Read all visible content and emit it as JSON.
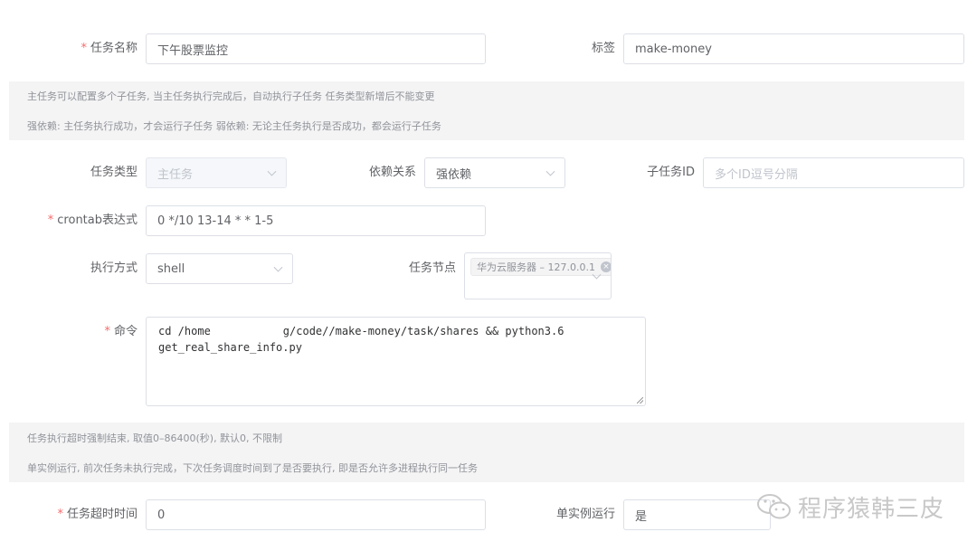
{
  "form": {
    "task_name": {
      "label": "任务名称",
      "value": "下午股票监控",
      "required": true
    },
    "tag": {
      "label": "标签",
      "value": "make-money"
    },
    "tips1": [
      "主任务可以配置多个子任务, 当主任务执行完成后，自动执行子任务 任务类型新增后不能变更",
      "强依赖: 主任务执行成功，才会运行子任务 弱依赖: 无论主任务执行是否成功，都会运行子任务"
    ],
    "task_type": {
      "label": "任务类型",
      "value": "主任务",
      "disabled": true
    },
    "dependency": {
      "label": "依赖关系",
      "value": "强依赖"
    },
    "child_task_id": {
      "label": "子任务ID",
      "placeholder": "多个ID逗号分隔"
    },
    "crontab": {
      "label": "crontab表达式",
      "value": "0 */10 13-14 * * 1-5",
      "required": true
    },
    "exec_mode": {
      "label": "执行方式",
      "value": "shell"
    },
    "task_node": {
      "label": "任务节点",
      "tag": "华为云服务器 – 127.0.0.1",
      "tag_close": "×"
    },
    "command": {
      "label": "命令",
      "required": true,
      "line1_pre": "cd /home",
      "line1_post": "g/code//make-money/task/shares && python3.6",
      "line2": "get_real_share_info.py"
    },
    "tips2": [
      "任务执行超时强制结束, 取值0–86400(秒), 默认0, 不限制",
      "单实例运行, 前次任务未执行完成，下次任务调度时间到了是否要执行, 即是否允许多进程执行同一任务"
    ],
    "timeout": {
      "label": "任务超时时间",
      "value": "0",
      "required": true
    },
    "single_instance": {
      "label": "单实例运行",
      "value": "是"
    },
    "required_mark": "*"
  },
  "watermark": {
    "text": "程序猿韩三皮",
    "icon": "wechat-icon"
  }
}
